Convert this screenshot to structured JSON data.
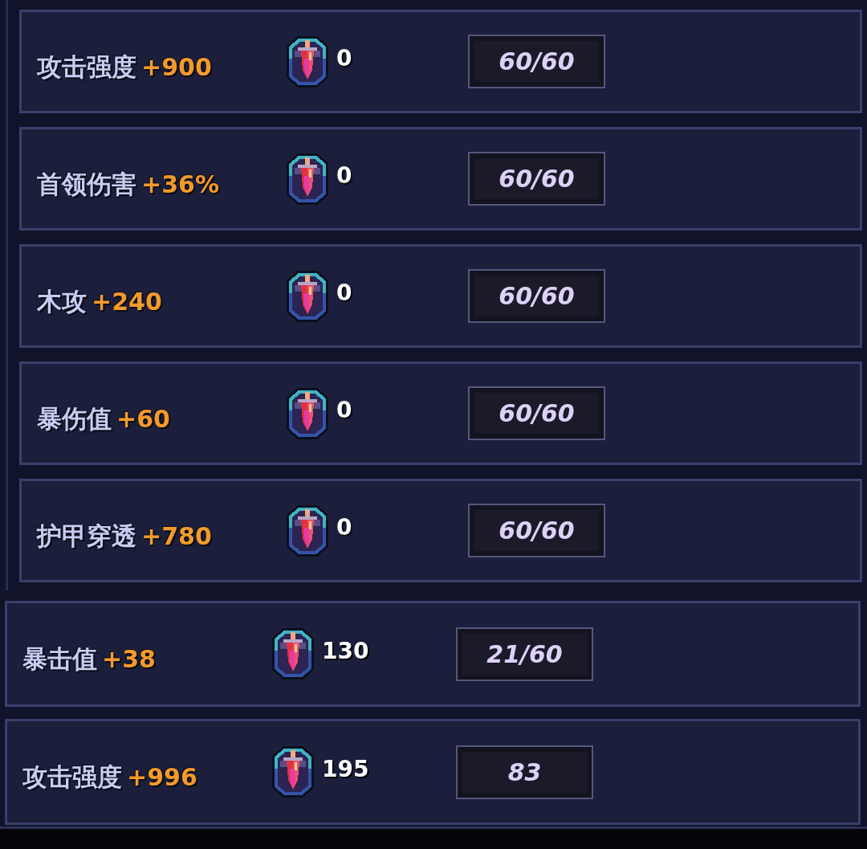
{
  "stat_group": {
    "rows": [
      {
        "name": "攻击强度",
        "bonus": "+900",
        "count": "0",
        "progress": "60/60"
      },
      {
        "name": "首领伤害",
        "bonus": "+36%",
        "count": "0",
        "progress": "60/60"
      },
      {
        "name": "木攻",
        "bonus": "+240",
        "count": "0",
        "progress": "60/60"
      },
      {
        "name": "暴伤值",
        "bonus": "+60",
        "count": "0",
        "progress": "60/60"
      },
      {
        "name": "护甲穿透",
        "bonus": "+780",
        "count": "0",
        "progress": "60/60"
      }
    ]
  },
  "stat_rows": [
    {
      "name": "暴击值",
      "bonus": "+38",
      "count": "130",
      "progress": "21/60"
    },
    {
      "name": "攻击强度",
      "bonus": "+996",
      "count": "195",
      "progress": "83"
    }
  ]
}
